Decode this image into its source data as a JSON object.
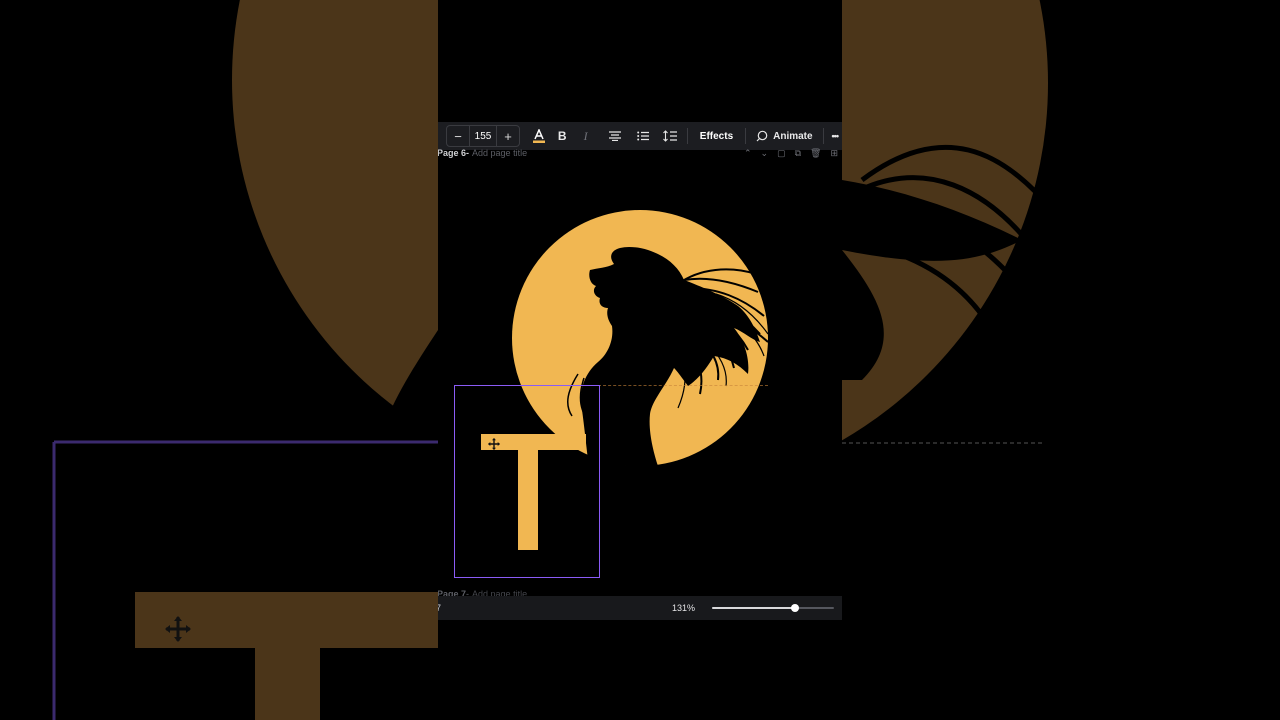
{
  "toolbar": {
    "font_size": "155",
    "decrease_label": "−",
    "increase_label": "+",
    "bold_label": "B",
    "italic_label": "I",
    "effects_label": "Effects",
    "animate_label": "Animate",
    "more_label": "•••"
  },
  "page6": {
    "name": "Page 6",
    "separator": " -",
    "title_placeholder": "Add page title"
  },
  "page7": {
    "name": "Page 7",
    "separator": " -",
    "title_placeholder": "Add page title"
  },
  "bottom": {
    "page_number": "7",
    "zoom": "131%",
    "zoom_fraction": 0.68
  },
  "colors": {
    "accent": "#8b5cf6",
    "moon": "#f1b752",
    "text_fill": "#f1b752",
    "toolbar_bg": "#1c1d21"
  },
  "icons": [
    "text-color-icon",
    "bold-icon",
    "italic-icon",
    "align-center-icon",
    "list-icon",
    "spacing-icon",
    "animate-icon",
    "more-icon",
    "chevron-up-icon",
    "chevron-down-icon",
    "lock-icon",
    "duplicate-icon",
    "delete-icon",
    "add-page-icon",
    "move-icon"
  ]
}
